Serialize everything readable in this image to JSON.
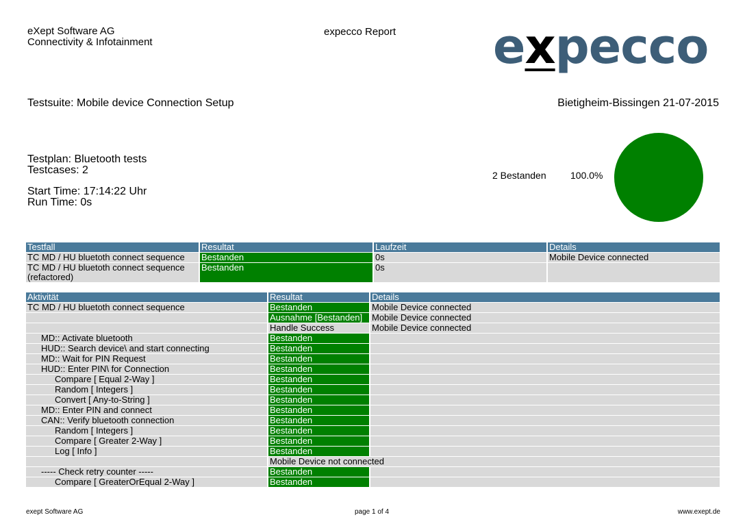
{
  "header": {
    "company_line1": "eXept Software AG",
    "company_line2": "Connectivity & Infotainment",
    "report_title": "expecco Report",
    "logo": {
      "pre": "e",
      "x": "x",
      "post": "pecco"
    }
  },
  "suite": {
    "testsuite": "Testsuite: Mobile device Connection Setup",
    "location_date": "Bietigheim-Bissingen 21-07-2015",
    "testplan": "Testplan: Bluetooth tests",
    "testcases": "Testcases: 2",
    "start_time": "Start Time: 17:14:22 Uhr",
    "run_time": "Run Time: 0s"
  },
  "summary": {
    "passed_label": "2 Bestanden",
    "passed_percent": "100.0%",
    "pie_color": "#008000",
    "passed_fraction": 1.0
  },
  "testcase_table": {
    "headers": [
      "Testfall",
      "Resultat",
      "Laufzeit",
      "Details"
    ],
    "rows": [
      {
        "name": "TC MD / HU bluetoth connect sequence",
        "result": "Bestanden",
        "time": "0s",
        "details": "Mobile Device connected"
      },
      {
        "name_line1": "TC MD / HU bluetoth connect sequence",
        "name_line2": "(refactored)",
        "result": "Bestanden",
        "time": "0s",
        "details": ""
      }
    ]
  },
  "activity_table": {
    "headers": [
      "Aktivität",
      "Resultat",
      "Details"
    ],
    "rows": [
      {
        "indent": 0,
        "name": "TC MD / HU bluetoth connect sequence",
        "result": "Bestanden",
        "pass": true,
        "details": "Mobile Device connected"
      },
      {
        "indent": 0,
        "name": "",
        "result": "Ausnahme [Bestanden]",
        "pass": true,
        "details": "Mobile Device connected"
      },
      {
        "indent": 0,
        "name": "",
        "result": "Handle Success",
        "pass": false,
        "details": "Mobile Device connected"
      },
      {
        "indent": 1,
        "name": "MD:: Activate bluetooth",
        "result": "Bestanden",
        "pass": true,
        "details": ""
      },
      {
        "indent": 1,
        "name": "HUD:: Search device\\ and start connecting",
        "result": "Bestanden",
        "pass": true,
        "details": ""
      },
      {
        "indent": 1,
        "name": "MD:: Wait for PIN Request",
        "result": "Bestanden",
        "pass": true,
        "details": ""
      },
      {
        "indent": 1,
        "name": "HUD:: Enter PIN\\ for Connection",
        "result": "Bestanden",
        "pass": true,
        "details": ""
      },
      {
        "indent": 2,
        "name": "Compare [ Equal 2-Way ]",
        "result": "Bestanden",
        "pass": true,
        "details": ""
      },
      {
        "indent": 2,
        "name": "Random [ Integers ]",
        "result": "Bestanden",
        "pass": true,
        "details": ""
      },
      {
        "indent": 2,
        "name": "Convert [ Any-to-String ]",
        "result": "Bestanden",
        "pass": true,
        "details": ""
      },
      {
        "indent": 1,
        "name": "MD:: Enter PIN and connect",
        "result": "Bestanden",
        "pass": true,
        "details": ""
      },
      {
        "indent": 1,
        "name": "CAN:: Verify bluetooth connection",
        "result": "Bestanden",
        "pass": true,
        "details": ""
      },
      {
        "indent": 2,
        "name": "Random [ Integers ]",
        "result": "Bestanden",
        "pass": true,
        "details": ""
      },
      {
        "indent": 2,
        "name": "Compare [ Greater 2-Way ]",
        "result": "Bestanden",
        "pass": true,
        "details": ""
      },
      {
        "indent": 2,
        "name": "Log [ Info ]",
        "result": "Bestanden",
        "pass": true,
        "details": ""
      },
      {
        "indent": 2,
        "name": "",
        "result": "Mobile Device not connected",
        "pass": false,
        "details": "",
        "span": true
      },
      {
        "indent": 1,
        "name": "----- Check retry counter -----",
        "result": "Bestanden",
        "pass": true,
        "details": ""
      },
      {
        "indent": 2,
        "name": "Compare [ GreaterOrEqual 2-Way ]",
        "result": "Bestanden",
        "pass": true,
        "details": ""
      }
    ]
  },
  "footer": {
    "left": "exept Software AG",
    "middle": "page 1 of 4",
    "right": "www.exept.de"
  }
}
